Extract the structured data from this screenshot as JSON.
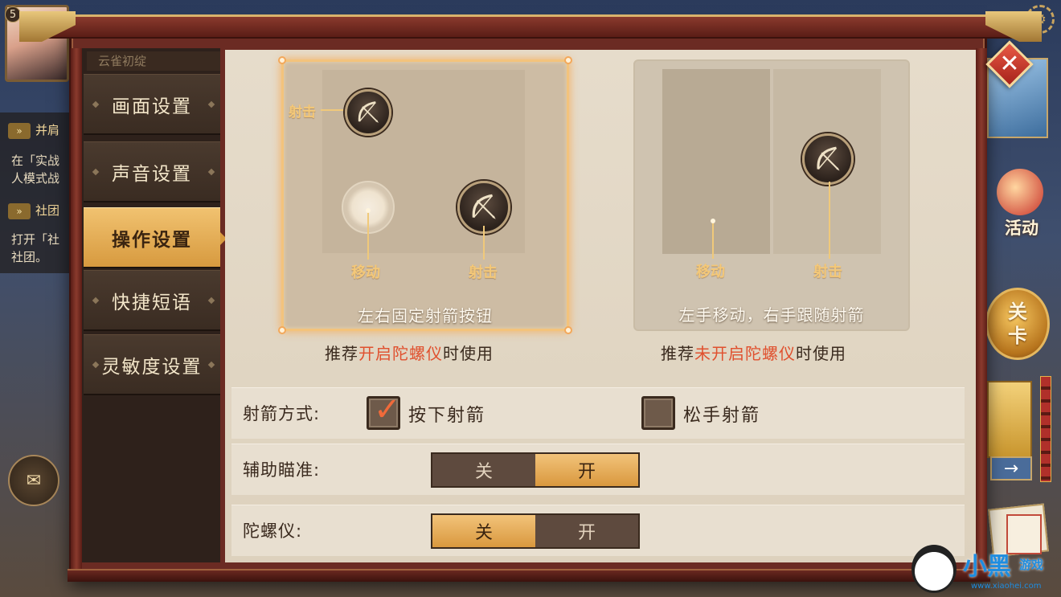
{
  "player": {
    "level": "5"
  },
  "background": {
    "left_rows": [
      {
        "tag": "»",
        "text": "并肩"
      },
      {
        "text": "在「实战"
      },
      {
        "text": "人模式战"
      },
      {
        "tag": "»",
        "text": "社团"
      },
      {
        "text": "打开「社"
      },
      {
        "text": "社团。"
      }
    ],
    "activity_label": "活动",
    "stage_button": [
      "关",
      "卡"
    ]
  },
  "sidebar": {
    "title": "云雀初绽",
    "items": [
      {
        "label": "画面设置",
        "active": false
      },
      {
        "label": "声音设置",
        "active": false
      },
      {
        "label": "操作设置",
        "active": true
      },
      {
        "label": "快捷短语",
        "active": false
      },
      {
        "label": "灵敏度设置",
        "active": false
      }
    ]
  },
  "layouts": {
    "left": {
      "labels": {
        "shoot_top": "射击",
        "move": "移动",
        "shoot": "射击"
      },
      "caption": "左右固定射箭按钮",
      "recommend_prefix": "推荐",
      "recommend_highlight": "开启陀螺仪",
      "recommend_suffix": "时使用",
      "selected": true
    },
    "right": {
      "labels": {
        "move": "移动",
        "shoot": "射击"
      },
      "caption": "左手移动，右手跟随射箭",
      "recommend_prefix": "推荐",
      "recommend_highlight": "未开启陀螺仪",
      "recommend_suffix": "时使用",
      "selected": false
    }
  },
  "settings": {
    "shoot_mode": {
      "label": "射箭方式:",
      "options": [
        {
          "label": "按下射箭",
          "checked": true
        },
        {
          "label": "松手射箭",
          "checked": false
        }
      ]
    },
    "aim_assist": {
      "label": "辅助瞄准:",
      "off_label": "关",
      "on_label": "开",
      "value": "on"
    },
    "gyroscope": {
      "label": "陀螺仪:",
      "off_label": "关",
      "on_label": "开",
      "value": "off"
    }
  },
  "colors": {
    "accent_gold": "#d9983e",
    "highlight_red": "#e0502e",
    "frame_red": "#6b2b23"
  },
  "watermark": {
    "brand": "小黑",
    "sub": "游戏",
    "url": "www.xiaohei.com"
  }
}
